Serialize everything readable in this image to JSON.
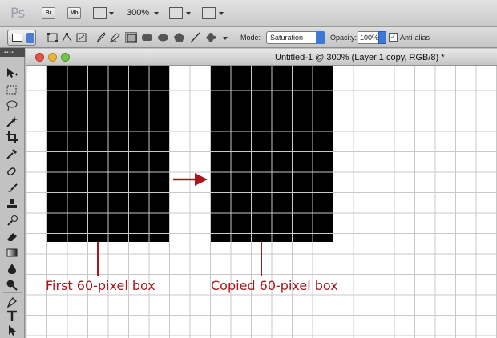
{
  "app": {
    "logo": "Ps",
    "bridge_label": "Br",
    "minibridge_label": "Mb",
    "zoom_level": "300%"
  },
  "options_bar": {
    "mode_label": "Mode:",
    "mode_value": "Saturation",
    "opacity_label": "Opacity:",
    "opacity_value": "100%",
    "antialias_label": "Anti-alias",
    "antialias_checked": true
  },
  "document": {
    "title": "Untitled-1 @ 300% (Layer 1 copy, RGB/8) *"
  },
  "annotations": {
    "first_box_caption": "First 60-pixel box",
    "copied_box_caption": "Copied 60-pixel box",
    "accent_color": "#a5171b"
  },
  "icons": [
    "home-icon",
    "view-extras-icon",
    "arrange-icon",
    "screen-mode-icon",
    "path-select-icon",
    "pen-icon",
    "rectangle-icon",
    "ellipse-icon",
    "polygon-icon",
    "line-icon",
    "custom-shape-icon"
  ]
}
